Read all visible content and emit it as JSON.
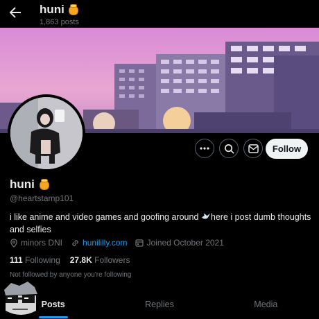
{
  "header": {
    "name": "huni",
    "post_count": "1,863 posts"
  },
  "profile": {
    "name": "huni",
    "handle": "@heartstamp101",
    "bio_before": "i like anime and video games and goofing around ",
    "bio_after": "here i post dumb thoughts and selfies",
    "location": "minors DNI",
    "link": "hunililly.com",
    "joined": "Joined October 2021",
    "following_count": "111",
    "following_label": "Following",
    "followers_count": "27.8K",
    "followers_label": "Followers",
    "not_followed": "Not followed by anyone you're following"
  },
  "actions": {
    "follow_label": "Follow"
  },
  "tabs": [
    {
      "label": "Posts"
    },
    {
      "label": "Replies"
    },
    {
      "label": "Media"
    }
  ],
  "colors": {
    "accent": "#1d9bf0",
    "background": "#000000",
    "muted": "#71767b"
  },
  "icons": [
    "back-arrow-icon",
    "honey-pot-emoji",
    "more-icon",
    "search-icon",
    "message-icon",
    "location-icon",
    "link-icon",
    "calendar-icon",
    "dove-emoji"
  ]
}
